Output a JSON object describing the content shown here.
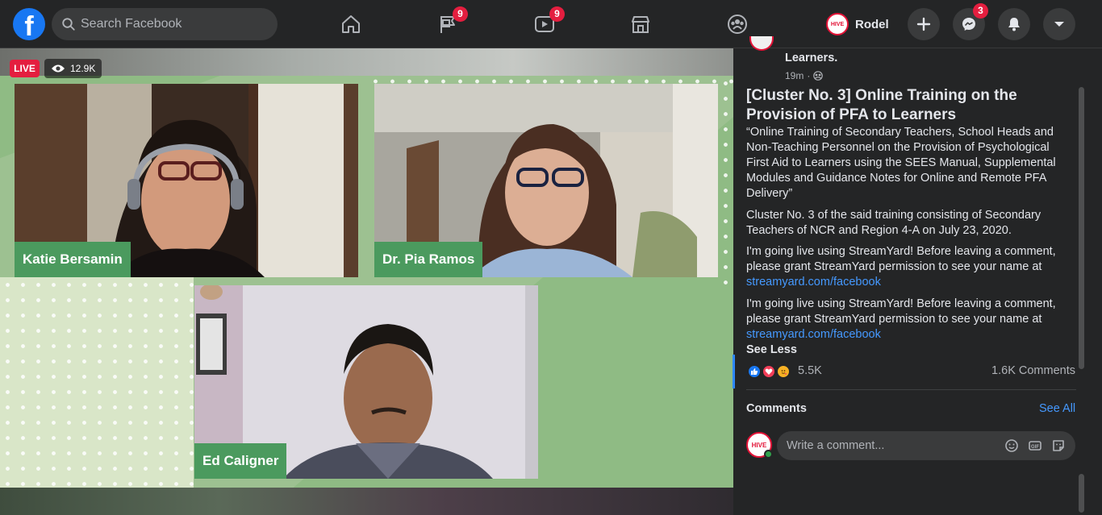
{
  "topbar": {
    "search_placeholder": "Search Facebook",
    "nav": [
      {
        "name": "home",
        "badge": ""
      },
      {
        "name": "pages",
        "badge": "9"
      },
      {
        "name": "watch",
        "badge": "9"
      },
      {
        "name": "marketplace",
        "badge": ""
      },
      {
        "name": "groups",
        "badge": ""
      }
    ],
    "profile_name": "Rodel",
    "messenger_badge": "3",
    "avatar_label": "HIVE"
  },
  "video": {
    "live_label": "LIVE",
    "viewer_count": "12.9K",
    "participants": [
      "Katie Bersamin",
      "Dr. Pia Ramos",
      "Ed Caligner"
    ]
  },
  "post": {
    "author_tail": "Learners.",
    "time": "19m",
    "title": "[Cluster No. 3] Online Training on the Provision of PFA to Learners",
    "para1": "“Online Training of Secondary Teachers, School Heads and Non-Teaching Personnel on the Provision of Psychological First Aid to Learners using the SEES Manual, Supplemental Modules and Guidance Notes for Online and Remote PFA Delivery”",
    "para2": "Cluster No. 3 of the said training consisting of Secondary Teachers of NCR and Region 4-A on July 23, 2020.",
    "para3": "I'm going live using StreamYard! Before leaving a comment, please grant StreamYard permission to see your name at",
    "link3": "streamyard.com/facebook",
    "para4": "I'm going live using StreamYard! Before leaving a comment, please grant StreamYard permission to see your name at",
    "link4": "streamyard.com/facebook",
    "see_less": "See Less",
    "reactions_count": "5.5K",
    "comments_count": "1.6K Comments"
  },
  "comments": {
    "heading": "Comments",
    "see_all": "See All",
    "input_placeholder": "Write a comment..."
  },
  "colors": {
    "accent": "#1877f2",
    "badge": "#e41e3f",
    "link": "#4599ff",
    "name_tag": "#4b9a5e"
  }
}
